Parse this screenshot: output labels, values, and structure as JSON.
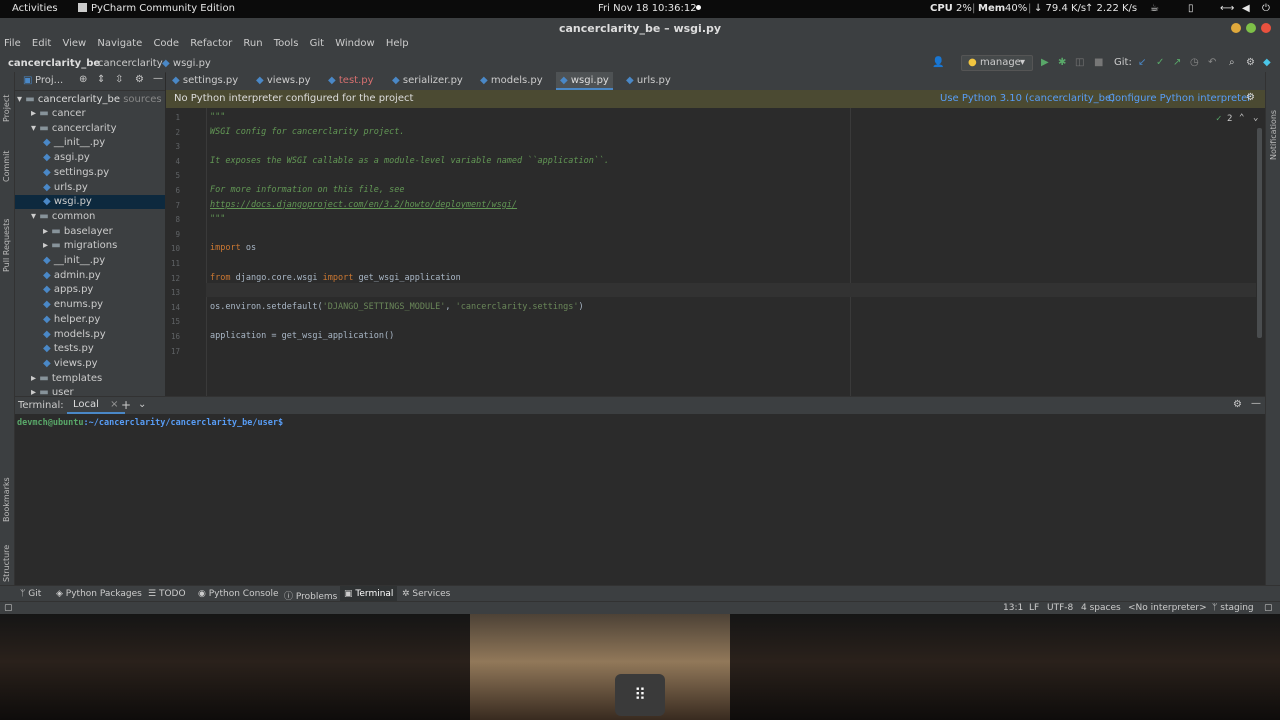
{
  "ubuntu": {
    "activities": "Activities",
    "app_name": "PyCharm Community Edition",
    "clock": "Fri Nov 18 10:36:12",
    "cpu_label": "CPU",
    "cpu_value": "2%",
    "mem_label": "Mem",
    "mem_value": "40%",
    "net_down": "↓ 79.4 K/s",
    "net_up": "↑ 2.22 K/s"
  },
  "window": {
    "title": "cancerclarity_be – wsgi.py"
  },
  "menu": [
    "File",
    "Edit",
    "View",
    "Navigate",
    "Code",
    "Refactor",
    "Run",
    "Tools",
    "Git",
    "Window",
    "Help"
  ],
  "breadcrumb": [
    "cancerclarity_be",
    "cancerclarity",
    "wsgi.py"
  ],
  "toolbar": {
    "run_config": "manage",
    "git_label": "Git:"
  },
  "project": {
    "header": "Proj...",
    "root": "cancerclarity_be",
    "root_hint": "sources",
    "items": [
      {
        "label": "cancer",
        "indent": 1,
        "type": "folder"
      },
      {
        "label": "cancerclarity",
        "indent": 1,
        "type": "folder"
      },
      {
        "label": "__init__.py",
        "indent": 2,
        "type": "py"
      },
      {
        "label": "asgi.py",
        "indent": 2,
        "type": "py"
      },
      {
        "label": "settings.py",
        "indent": 2,
        "type": "py"
      },
      {
        "label": "urls.py",
        "indent": 2,
        "type": "py"
      },
      {
        "label": "wsgi.py",
        "indent": 2,
        "type": "py",
        "selected": true
      },
      {
        "label": "common",
        "indent": 1,
        "type": "folder"
      },
      {
        "label": "baselayer",
        "indent": 2,
        "type": "folder"
      },
      {
        "label": "migrations",
        "indent": 2,
        "type": "folder"
      },
      {
        "label": "__init__.py",
        "indent": 2,
        "type": "py"
      },
      {
        "label": "admin.py",
        "indent": 2,
        "type": "py"
      },
      {
        "label": "apps.py",
        "indent": 2,
        "type": "py"
      },
      {
        "label": "enums.py",
        "indent": 2,
        "type": "py"
      },
      {
        "label": "helper.py",
        "indent": 2,
        "type": "py"
      },
      {
        "label": "models.py",
        "indent": 2,
        "type": "py"
      },
      {
        "label": "tests.py",
        "indent": 2,
        "type": "py"
      },
      {
        "label": "views.py",
        "indent": 2,
        "type": "py"
      },
      {
        "label": "templates",
        "indent": 1,
        "type": "folder"
      },
      {
        "label": "user",
        "indent": 1,
        "type": "folder"
      }
    ]
  },
  "tabs": [
    {
      "label": "settings.py"
    },
    {
      "label": "views.py"
    },
    {
      "label": "test.py"
    },
    {
      "label": "serializer.py"
    },
    {
      "label": "models.py"
    },
    {
      "label": "wsgi.py",
      "active": true
    },
    {
      "label": "urls.py"
    }
  ],
  "warning": {
    "text": "No Python interpreter configured for the project",
    "use_python": "Use Python 3.10 (cancerclarity_be)",
    "configure": "Configure Python interpreter"
  },
  "editor": {
    "inspection_count": "2",
    "lines": [
      {
        "n": "1",
        "t": "\"\"\"",
        "cls": "cmt"
      },
      {
        "n": "2",
        "t": "WSGI config for cancerclarity project.",
        "cls": "cmt"
      },
      {
        "n": "3",
        "t": "",
        "cls": "cmt"
      },
      {
        "n": "4",
        "t": "It exposes the WSGI callable as a module-level variable named ``application``.",
        "cls": "cmt"
      },
      {
        "n": "5",
        "t": "",
        "cls": "cmt"
      },
      {
        "n": "6",
        "t": "For more information on this file, see",
        "cls": "cmt"
      },
      {
        "n": "7",
        "t": "https://docs.djangoproject.com/en/3.2/howto/deployment/wsgi/",
        "cls": "cmt"
      },
      {
        "n": "8",
        "t": "\"\"\"",
        "cls": "cmt"
      },
      {
        "n": "9",
        "t": "",
        "cls": ""
      },
      {
        "n": "10",
        "t": "import os",
        "cls": ""
      },
      {
        "n": "11",
        "t": "",
        "cls": ""
      },
      {
        "n": "12",
        "t": "from django.core.wsgi import get_wsgi_application",
        "cls": ""
      },
      {
        "n": "13",
        "t": "",
        "cls": ""
      },
      {
        "n": "14",
        "t": "os.environ.setdefault('DJANGO_SETTINGS_MODULE', 'cancerclarity.settings')",
        "cls": ""
      },
      {
        "n": "15",
        "t": "",
        "cls": ""
      },
      {
        "n": "16",
        "t": "application = get_wsgi_application()",
        "cls": ""
      },
      {
        "n": "17",
        "t": "",
        "cls": ""
      }
    ]
  },
  "terminal": {
    "title": "Terminal:",
    "tab": "Local",
    "prompt_user": "devmch@ubuntu",
    "prompt_path": ":~/cancerclarity/cancerclarity_be/user$"
  },
  "toolwindows": [
    "Git",
    "Python Packages",
    "TODO",
    "Python Console",
    "Problems",
    "Terminal",
    "Services"
  ],
  "status": {
    "position": "13:1",
    "line_sep": "LF",
    "encoding": "UTF-8",
    "indent": "4 spaces",
    "interpreter": "<No interpreter>",
    "branch": "staging"
  },
  "side_labels": {
    "project": "Project",
    "commit": "Commit",
    "pull": "Pull Requests",
    "bookmarks": "Bookmarks",
    "structure": "Structure",
    "notifications": "Notifications"
  },
  "colors": {
    "accent": "#4a88c7",
    "warning_bg": "#4b4a32",
    "editor_bg": "#2b2b2b",
    "panel_bg": "#3c3f41"
  }
}
